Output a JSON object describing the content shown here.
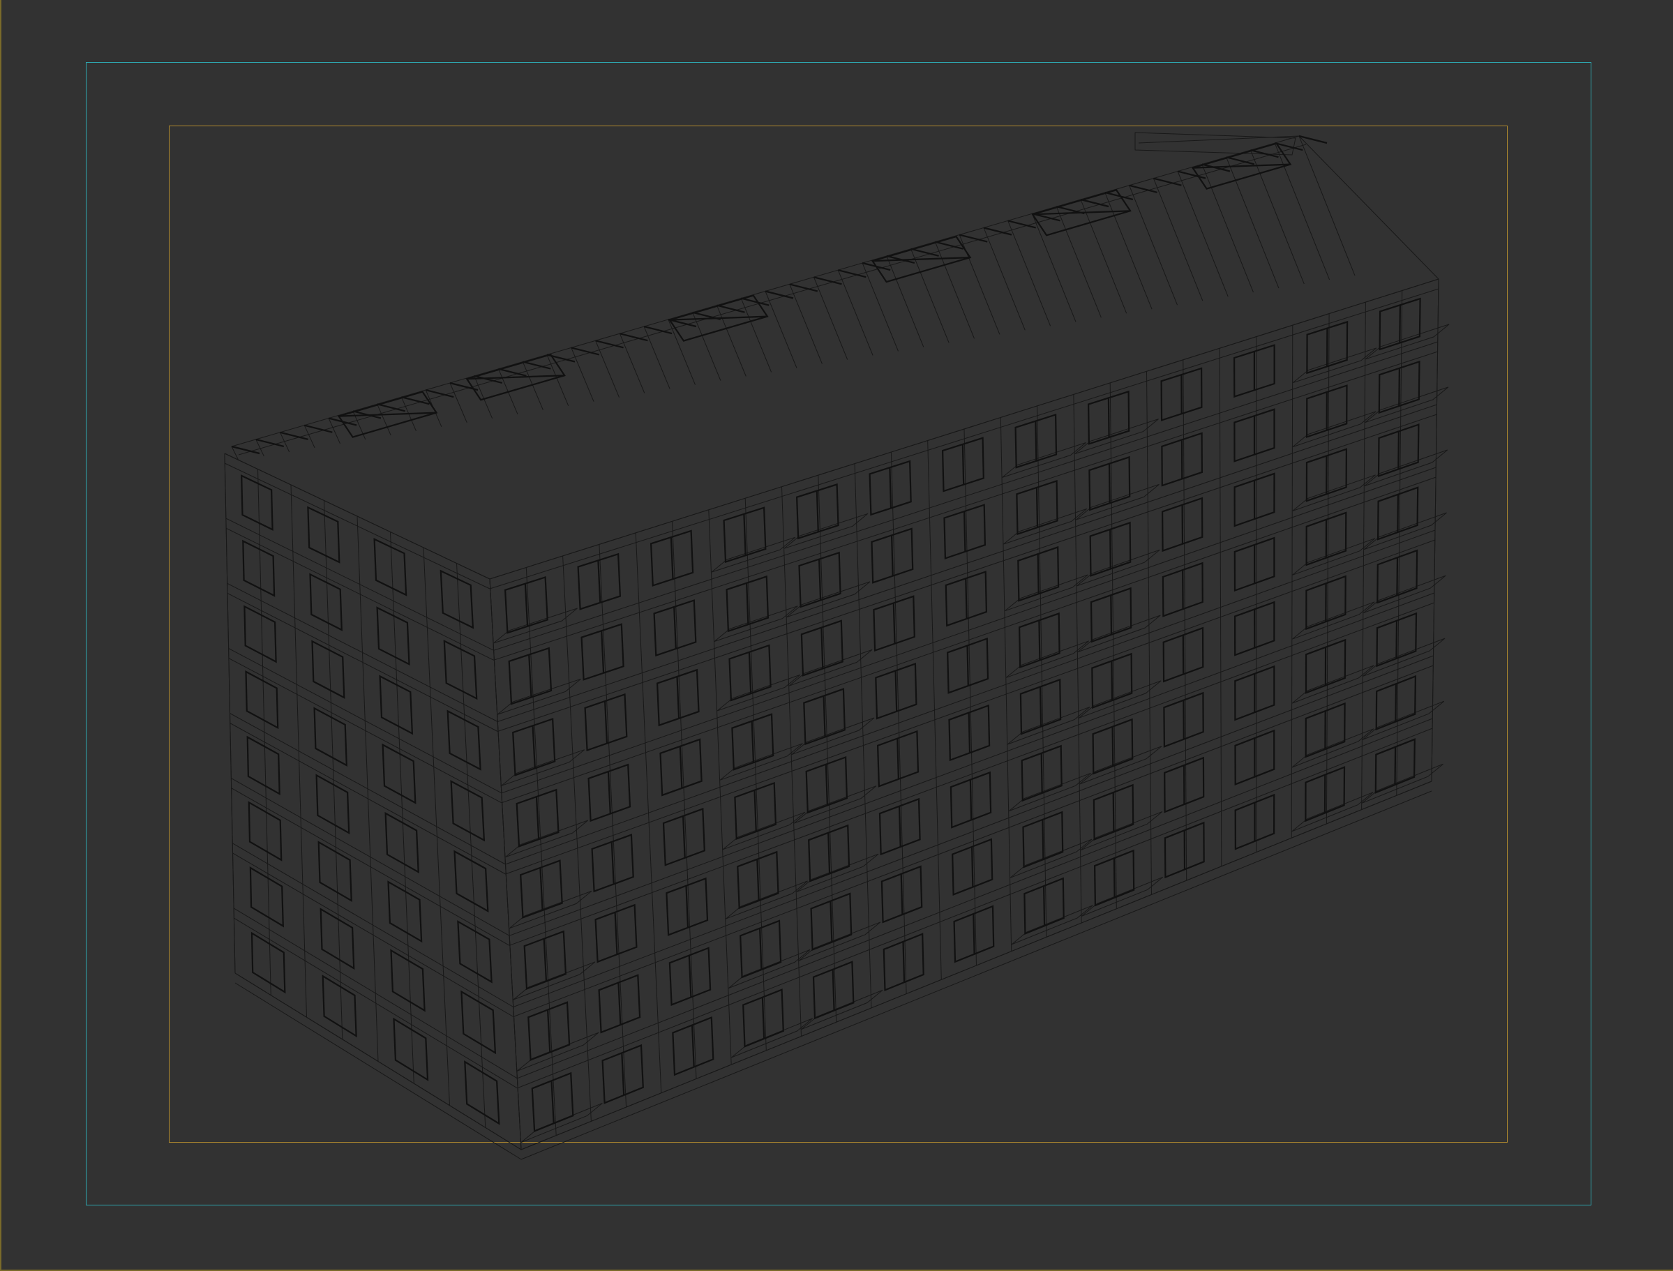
{
  "viewport": {
    "background_color": "#323232",
    "safe_frame_outer_color": "#2ea7b0",
    "safe_frame_inner_color": "#b08a2e",
    "wire_color": "#141414"
  },
  "scene": {
    "object": "building-wireframe",
    "floors": 8,
    "front_columns": 13,
    "side_columns": 4
  }
}
